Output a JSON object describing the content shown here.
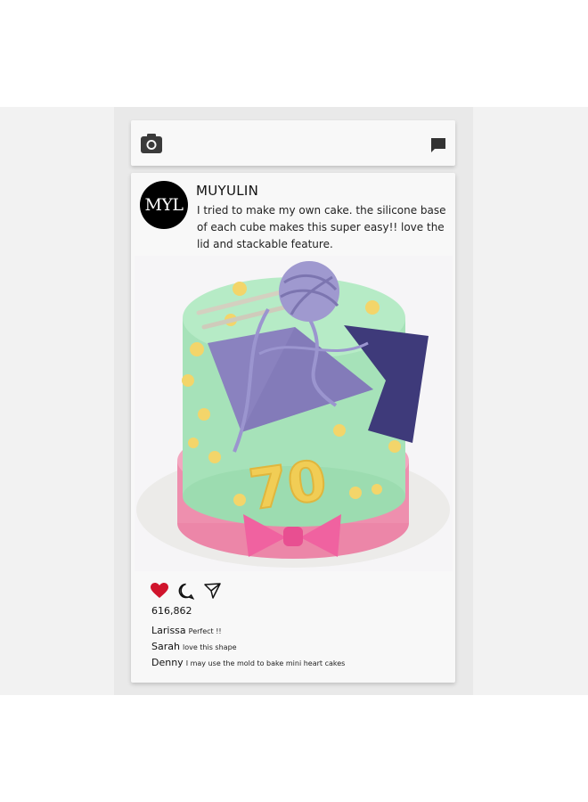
{
  "header": {
    "camera_icon": "camera-icon",
    "chat_icon": "chat-bubble-icon"
  },
  "post": {
    "avatar_text": "MYL",
    "username": "MUYULIN",
    "caption": "I tried to make my own cake. the silicone base of each cube makes this super easy!! love the lid and stackable feature.",
    "image_description": "",
    "photo_text": "70",
    "likes": "616,862",
    "like_color": "#d0142c"
  },
  "actions": [
    "heart-icon",
    "comment-icon",
    "share-icon"
  ],
  "comments": [
    {
      "user": "Larissa",
      "text": "Perfect !!"
    },
    {
      "user": "Sarah",
      "text": "love this shape"
    },
    {
      "user": "Denny",
      "text": "I may use the mold to bake mini heart cakes"
    }
  ]
}
